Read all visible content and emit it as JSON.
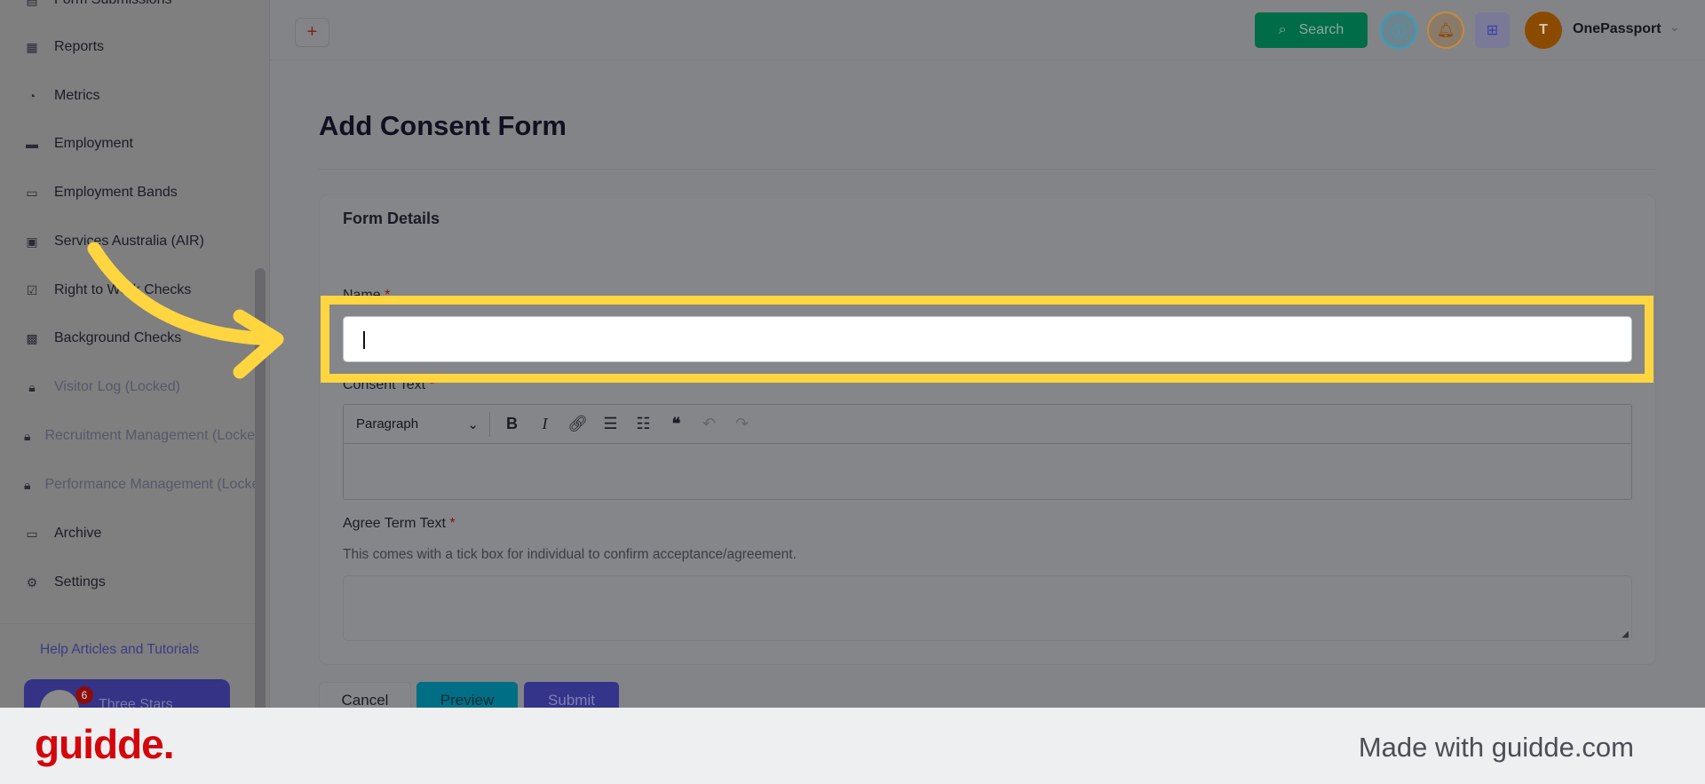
{
  "sidebar": {
    "items": [
      {
        "label": "Form Submissions",
        "icon": "form-icon",
        "locked": false
      },
      {
        "label": "Reports",
        "icon": "report-icon",
        "locked": false
      },
      {
        "label": "Metrics",
        "icon": "pie-chart-icon",
        "locked": false
      },
      {
        "label": "Employment",
        "icon": "briefcase-icon",
        "locked": false
      },
      {
        "label": "Employment Bands",
        "icon": "briefcase-outline-icon",
        "locked": false
      },
      {
        "label": "Services Australia (AIR)",
        "icon": "id-card-icon",
        "locked": false
      },
      {
        "label": "Right to Work Checks",
        "icon": "clipboard-check-icon",
        "locked": false
      },
      {
        "label": "Background Checks",
        "icon": "document-icon",
        "locked": false
      },
      {
        "label": "Visitor Log (Locked)",
        "icon": "lock-icon",
        "locked": true
      },
      {
        "label": "Recruitment Management (Locked)",
        "icon": "lock-icon",
        "locked": true
      },
      {
        "label": "Performance Management (Locked)",
        "icon": "lock-icon",
        "locked": true
      },
      {
        "label": "Archive",
        "icon": "archive-icon",
        "locked": false
      },
      {
        "label": "Settings",
        "icon": "gear-icon",
        "locked": false
      }
    ],
    "help_link": "Help Articles and Tutorials",
    "org": {
      "name": "Three Stars",
      "badge": "6"
    }
  },
  "topbar": {
    "add": "+",
    "search": "Search",
    "avatar_initial": "T",
    "user": "OnePassport"
  },
  "page": {
    "title": "Add Consent Form",
    "card_title": "Form Details",
    "name_label": "Name",
    "name_value": "",
    "consent_label": "Consent Text",
    "paragraph": "Paragraph",
    "agree_label": "Agree Term Text",
    "agree_hint": "This comes with a tick box for individual to confirm acceptance/agreement.",
    "required": "*",
    "cancel": "Cancel",
    "preview": "Preview",
    "submit": "Submit"
  },
  "footer": {
    "logo": "guidde.",
    "made_with": "Made with guidde.com"
  },
  "colors": {
    "highlight": "#ffd540",
    "brand": "#d3060b",
    "search": "#00a86b",
    "submit": "#4f4fd1"
  }
}
